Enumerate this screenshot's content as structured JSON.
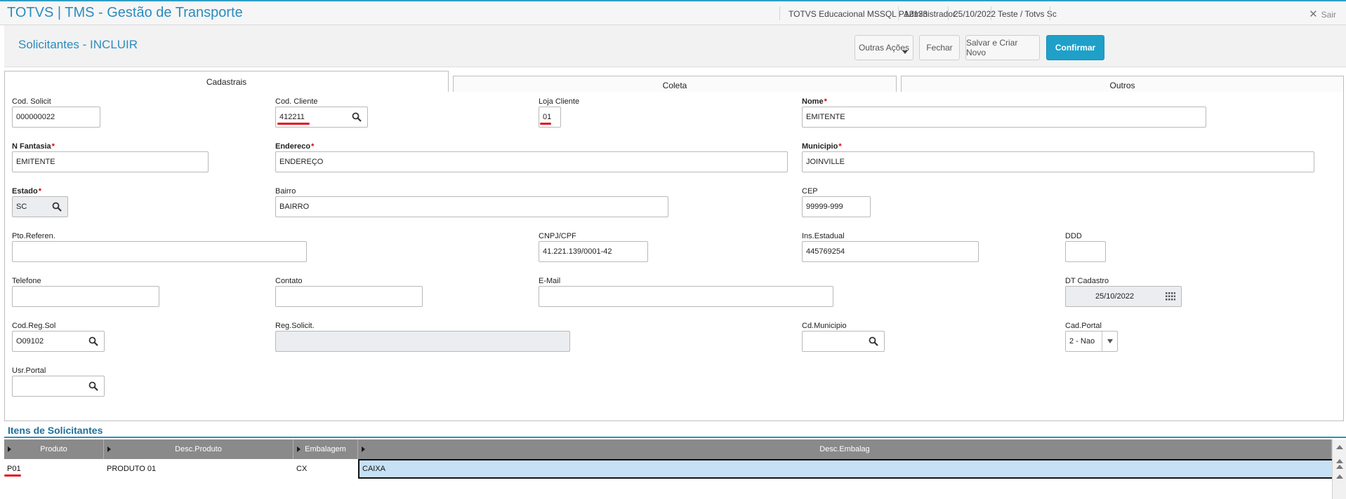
{
  "app": {
    "title": "TOTVS | TMS - Gestão de Transporte",
    "environment": "TOTVS Educacional MSSQL P12133",
    "user": "Administrador",
    "date": "25/10/2022",
    "branch": "Teste / Totvs Sc",
    "exit_label": "Sair"
  },
  "page": {
    "title": "Solicitantes - INCLUIR",
    "actions": {
      "more": "Outras Ações",
      "close": "Fechar",
      "save_new": "Salvar e Criar Novo",
      "confirm": "Confirmar"
    }
  },
  "tabs": [
    "Cadastrais",
    "Coleta",
    "Outros"
  ],
  "form": {
    "cod_solicit": {
      "label": "Cod. Solicit",
      "value": "000000022"
    },
    "cod_cliente": {
      "label": "Cod. Cliente",
      "value": "412211"
    },
    "loja_cliente": {
      "label": "Loja Cliente",
      "value": "01"
    },
    "nome": {
      "label": "Nome",
      "value": "EMITENTE"
    },
    "n_fantasia": {
      "label": "N Fantasia",
      "value": "EMITENTE"
    },
    "endereco": {
      "label": "Endereco",
      "value": "ENDEREÇO"
    },
    "municipio": {
      "label": "Municipio",
      "value": "JOINVILLE"
    },
    "estado": {
      "label": "Estado",
      "value": "SC"
    },
    "bairro": {
      "label": "Bairro",
      "value": "BAIRRO"
    },
    "cep": {
      "label": "CEP",
      "value": "99999-999"
    },
    "pto_referen": {
      "label": "Pto.Referen.",
      "value": ""
    },
    "cnpj_cpf": {
      "label": "CNPJ/CPF",
      "value": "41.221.139/0001-42"
    },
    "ins_estadual": {
      "label": "Ins.Estadual",
      "value": "445769254"
    },
    "ddd": {
      "label": "DDD",
      "value": ""
    },
    "telefone": {
      "label": "Telefone",
      "value": ""
    },
    "contato": {
      "label": "Contato",
      "value": ""
    },
    "email": {
      "label": "E-Mail",
      "value": ""
    },
    "dt_cadastro": {
      "label": "DT Cadastro",
      "value": "25/10/2022"
    },
    "cod_reg_sol": {
      "label": "Cod.Reg.Sol",
      "value": "O09102"
    },
    "reg_solicit": {
      "label": "Reg.Solicit.",
      "value": ""
    },
    "cd_municipio": {
      "label": "Cd.Municipio",
      "value": ""
    },
    "cad_portal": {
      "label": "Cad.Portal",
      "value": "2 - Nao"
    },
    "usr_portal": {
      "label": "Usr.Portal",
      "value": ""
    }
  },
  "grid": {
    "title": "Itens de Solicitantes",
    "columns": [
      "Produto",
      "Desc.Produto",
      "Embalagem",
      "Desc.Embalag"
    ],
    "rows": [
      [
        "P01",
        "PRODUTO 01",
        "CX",
        "CAIXA"
      ]
    ]
  },
  "colors": {
    "accent": "#2b8cbf",
    "primary_button": "#1ea0c9",
    "required": "#d00000",
    "highlight": "#e3101a",
    "grid_header": "#8a8a8a",
    "selected_cell": "#c6e0f5"
  }
}
